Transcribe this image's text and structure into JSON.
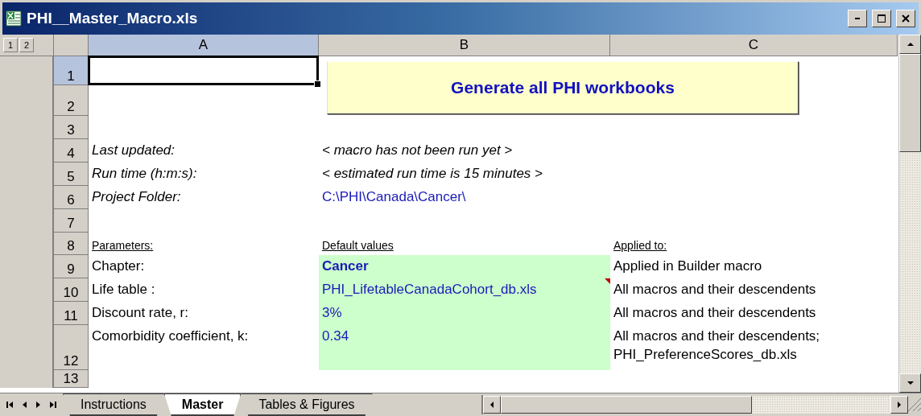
{
  "window": {
    "title": "PHI__Master_Macro.xls"
  },
  "outline_levels": [
    "1",
    "2"
  ],
  "columns": [
    {
      "label": "A",
      "selected": true
    },
    {
      "label": "B",
      "selected": false
    },
    {
      "label": "C",
      "selected": false
    }
  ],
  "macro_button": {
    "label": "Generate all PHI workbooks"
  },
  "rows": [
    {
      "number": "1",
      "selected": true
    },
    {
      "number": "2",
      "selected": false
    },
    {
      "number": "3",
      "selected": false
    },
    {
      "number": "4",
      "selected": false,
      "col_a": {
        "kind": "italic",
        "text": "Last updated:"
      },
      "col_b": {
        "kind": "italic",
        "text": "< macro has not been run yet >"
      }
    },
    {
      "number": "5",
      "selected": false,
      "col_a": {
        "kind": "italic",
        "text": "Run time (h:m:s):"
      },
      "col_b": {
        "kind": "italic",
        "text": "< estimated run time is 15 minutes >"
      }
    },
    {
      "number": "6",
      "selected": false,
      "col_a": {
        "kind": "italic",
        "text": "Project Folder:"
      },
      "col_b": {
        "kind": "value",
        "text": "C:\\PHI\\Canada\\Cancer\\"
      }
    },
    {
      "number": "7",
      "selected": false
    },
    {
      "number": "8",
      "selected": false,
      "col_a": {
        "kind": "heading",
        "text": "Parameters:"
      },
      "col_b": {
        "kind": "heading",
        "text": "Default values"
      },
      "col_c": {
        "kind": "heading",
        "text": "Applied to:"
      }
    },
    {
      "number": "9",
      "selected": false,
      "col_a": {
        "kind": "plain",
        "text": "Chapter:"
      },
      "col_b": {
        "kind": "strong-value",
        "text": "Cancer",
        "highlight": true
      },
      "col_c": {
        "kind": "plain",
        "text": "Applied in Builder macro"
      }
    },
    {
      "number": "10",
      "selected": false,
      "col_a": {
        "kind": "plain",
        "text": "Life table :"
      },
      "col_b": {
        "kind": "value",
        "text": "PHI_LifetableCanadaCohort_db.xls",
        "highlight": true,
        "comment": true
      },
      "col_c": {
        "kind": "plain",
        "text": "All macros and their descendents"
      }
    },
    {
      "number": "11",
      "selected": false,
      "col_a": {
        "kind": "plain",
        "text": "Discount rate, r:"
      },
      "col_b": {
        "kind": "value",
        "text": "3%",
        "highlight": true
      },
      "col_c": {
        "kind": "plain",
        "text": "All macros and their descendents"
      }
    },
    {
      "number": "12",
      "selected": false,
      "col_a": {
        "kind": "plain",
        "text": "Comorbidity coefficient, k:"
      },
      "col_b": {
        "kind": "value",
        "text": "0.34",
        "highlight": true
      },
      "col_c": {
        "kind": "plain",
        "text": "All macros and their descendents;\nPHI_PreferenceScores_db.xls"
      }
    },
    {
      "number": "13",
      "selected": false
    }
  ],
  "sheet_tabs": [
    {
      "label": "Instructions",
      "selected": false
    },
    {
      "label": "Master",
      "selected": true
    },
    {
      "label": "Tables & Figures",
      "selected": false
    }
  ]
}
